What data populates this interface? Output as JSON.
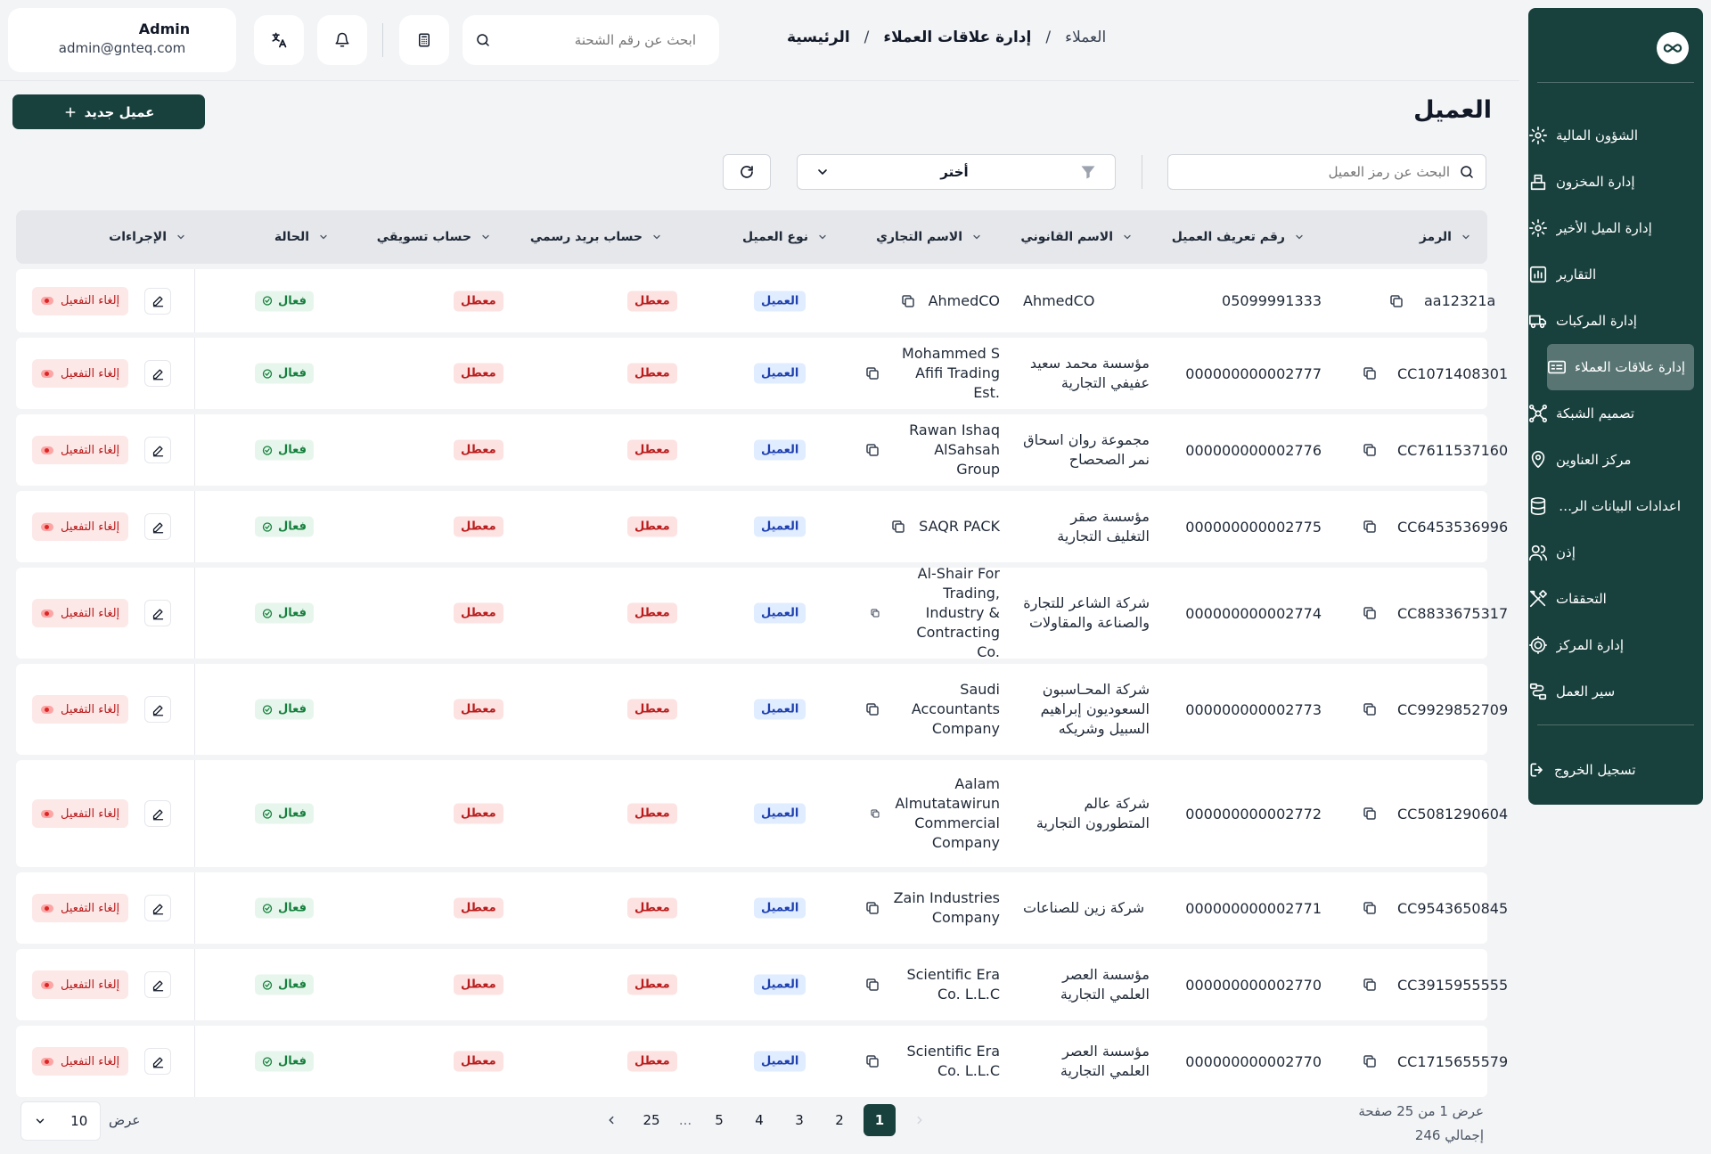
{
  "sidebar": {
    "items": [
      {
        "label": "الشؤون المالية",
        "icon": "finance-gear-icon"
      },
      {
        "label": "إدارة المخزون",
        "icon": "inventory-icon"
      },
      {
        "label": "إدارة الميل الأخير",
        "icon": "last-mile-gear-icon"
      },
      {
        "label": "التقارير",
        "icon": "chart-icon"
      },
      {
        "label": "إدارة المركبات",
        "icon": "truck-icon"
      },
      {
        "label": "إدارة علاقات العملاء",
        "icon": "crm-icon",
        "active": true
      },
      {
        "label": "تصميم الشبكة",
        "icon": "network-icon"
      },
      {
        "label": "مركز العناوين",
        "icon": "map-pin-icon"
      },
      {
        "label": "اعدادات البيانات الرئيسية",
        "icon": "database-icon"
      },
      {
        "label": "إذن",
        "icon": "users-icon"
      },
      {
        "label": "التحققات",
        "icon": "tools-icon"
      },
      {
        "label": "إدارة المركز",
        "icon": "hub-gear-icon"
      },
      {
        "label": "سير العمل",
        "icon": "workflow-icon"
      }
    ],
    "logout_label": "تسجيل الخروج"
  },
  "header": {
    "user_name": "Admin",
    "user_email": "admin@gnteq.com",
    "search_placeholder": "ابحث عن رقم الشحنة",
    "breadcrumbs": [
      "الرئيسية",
      "إدارة علاقات العملاء",
      "العملاء"
    ],
    "separator": "/"
  },
  "page": {
    "title": "العميل",
    "new_button": "عميل جديد",
    "filter_search_placeholder": "البحث عن رمز العميل",
    "filter_select": "أختر"
  },
  "table": {
    "columns": [
      "الرمز",
      "رقم تعريف العميل",
      "الاسم القانوني",
      "الاسم التجاري",
      "نوع العميل",
      "حساب بريد رسمي",
      "حساب تسويقي",
      "الحالة",
      "الإجراءات"
    ],
    "type_label": "العميل",
    "disabled_label": "معطل",
    "active_label": "فعال",
    "deactivate_label": "إلغاء التفعيل",
    "rows": [
      {
        "code": "aa12321a",
        "id": "05099991333",
        "legal": "AhmedCO",
        "trade": "AhmedCO"
      },
      {
        "code": "CC1071408301",
        "id": "000000000002777",
        "legal": "مؤسسة محمد سعيد عفيفي التجارية",
        "trade": "Mohammed S Afifi Trading Est."
      },
      {
        "code": "CC7611537160",
        "id": "000000000002776",
        "legal": "مجموعة روان اسحاق نمر الصحصاح",
        "trade": "Rawan Ishaq AlSahsah Group"
      },
      {
        "code": "CC6453536996",
        "id": "000000000002775",
        "legal": "مؤسسة صقر التغليف التجارية",
        "trade": "SAQR PACK"
      },
      {
        "code": "CC8833675317",
        "id": "000000000002774",
        "legal": "شركة الشاعر للتجارة والصناعة والمقاولات",
        "trade": "Al-Shair For Trading, Industry & Contracting Co."
      },
      {
        "code": "CC9929852709",
        "id": "000000000002773",
        "legal": "شركة المحـاسبون السعوديون إبراهيم السبيل وشريكه",
        "trade": "Saudi Accountants Company"
      },
      {
        "code": "CC5081290604",
        "id": "000000000002772",
        "legal": "شركة عالم المتطورون التجارية",
        "trade": "Aalam Almutatawirun Commercial Company"
      },
      {
        "code": "CC9543650845",
        "id": "000000000002771",
        "legal": "شركة زين للصناعات",
        "trade": "Zain Industries Company"
      },
      {
        "code": "CC3915955555",
        "id": "000000000002770",
        "legal": "مؤسسة العصر العلمي التجارية",
        "trade": "Scientific Era Co. L.L.C"
      },
      {
        "code": "CC1715655579",
        "id": "000000000002770",
        "legal": "مؤسسة العصر العلمي التجارية",
        "trade": "Scientific Era Co. L.L.C"
      }
    ]
  },
  "pagination": {
    "pages": [
      "1",
      "2",
      "3",
      "4",
      "5",
      "...",
      "25"
    ],
    "current": "1",
    "page_size": "10",
    "show_label": "عرض",
    "summary_pages": "عرض 1 من 25 صفحة",
    "summary_total": "إجمالي 246"
  }
}
